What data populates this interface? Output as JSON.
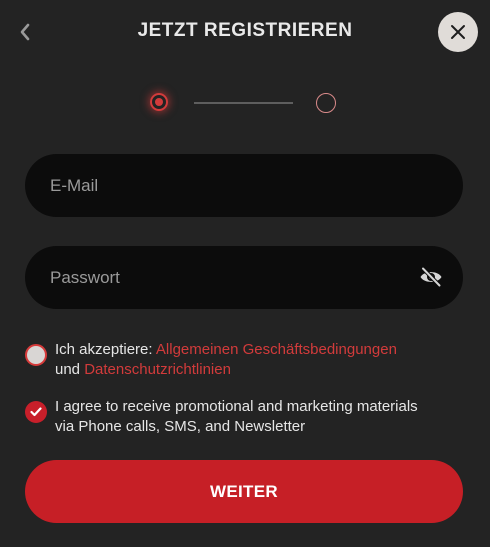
{
  "header": {
    "title": "JETZT REGISTRIEREN",
    "back_icon": "chevron-left-icon",
    "close_icon": "close-icon"
  },
  "stepper": {
    "current_step": 1,
    "total_steps": 2
  },
  "form": {
    "email": {
      "placeholder": "E-Mail",
      "value": ""
    },
    "password": {
      "placeholder": "Passwort",
      "value": "",
      "toggle_icon": "eye-off-icon"
    },
    "terms": {
      "checked": false,
      "prefix": "Ich akzeptiere: ",
      "link1": "Allgemeinen Geschäftsbedingungen",
      "middle": "und",
      "link2": "Datenschutzrichtlinien"
    },
    "marketing": {
      "checked": true,
      "text": "I agree to receive promotional and marketing materials via Phone calls, SMS, and Newsletter"
    },
    "submit_label": "WEITER"
  },
  "colors": {
    "background": "#232323",
    "field_background": "#0c0c0c",
    "accent": "#c61f26",
    "link": "#d23b3b"
  }
}
